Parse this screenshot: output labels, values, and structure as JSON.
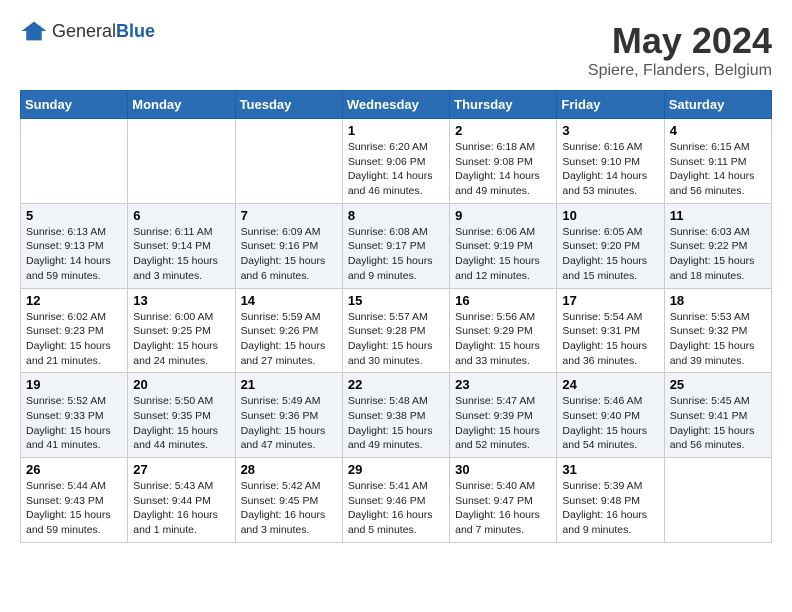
{
  "header": {
    "logo_general": "General",
    "logo_blue": "Blue",
    "title": "May 2024",
    "subtitle": "Spiere, Flanders, Belgium"
  },
  "calendar": {
    "days_of_week": [
      "Sunday",
      "Monday",
      "Tuesday",
      "Wednesday",
      "Thursday",
      "Friday",
      "Saturday"
    ],
    "weeks": [
      [
        {
          "day": "",
          "info": ""
        },
        {
          "day": "",
          "info": ""
        },
        {
          "day": "",
          "info": ""
        },
        {
          "day": "1",
          "info": "Sunrise: 6:20 AM\nSunset: 9:06 PM\nDaylight: 14 hours\nand 46 minutes."
        },
        {
          "day": "2",
          "info": "Sunrise: 6:18 AM\nSunset: 9:08 PM\nDaylight: 14 hours\nand 49 minutes."
        },
        {
          "day": "3",
          "info": "Sunrise: 6:16 AM\nSunset: 9:10 PM\nDaylight: 14 hours\nand 53 minutes."
        },
        {
          "day": "4",
          "info": "Sunrise: 6:15 AM\nSunset: 9:11 PM\nDaylight: 14 hours\nand 56 minutes."
        }
      ],
      [
        {
          "day": "5",
          "info": "Sunrise: 6:13 AM\nSunset: 9:13 PM\nDaylight: 14 hours\nand 59 minutes."
        },
        {
          "day": "6",
          "info": "Sunrise: 6:11 AM\nSunset: 9:14 PM\nDaylight: 15 hours\nand 3 minutes."
        },
        {
          "day": "7",
          "info": "Sunrise: 6:09 AM\nSunset: 9:16 PM\nDaylight: 15 hours\nand 6 minutes."
        },
        {
          "day": "8",
          "info": "Sunrise: 6:08 AM\nSunset: 9:17 PM\nDaylight: 15 hours\nand 9 minutes."
        },
        {
          "day": "9",
          "info": "Sunrise: 6:06 AM\nSunset: 9:19 PM\nDaylight: 15 hours\nand 12 minutes."
        },
        {
          "day": "10",
          "info": "Sunrise: 6:05 AM\nSunset: 9:20 PM\nDaylight: 15 hours\nand 15 minutes."
        },
        {
          "day": "11",
          "info": "Sunrise: 6:03 AM\nSunset: 9:22 PM\nDaylight: 15 hours\nand 18 minutes."
        }
      ],
      [
        {
          "day": "12",
          "info": "Sunrise: 6:02 AM\nSunset: 9:23 PM\nDaylight: 15 hours\nand 21 minutes."
        },
        {
          "day": "13",
          "info": "Sunrise: 6:00 AM\nSunset: 9:25 PM\nDaylight: 15 hours\nand 24 minutes."
        },
        {
          "day": "14",
          "info": "Sunrise: 5:59 AM\nSunset: 9:26 PM\nDaylight: 15 hours\nand 27 minutes."
        },
        {
          "day": "15",
          "info": "Sunrise: 5:57 AM\nSunset: 9:28 PM\nDaylight: 15 hours\nand 30 minutes."
        },
        {
          "day": "16",
          "info": "Sunrise: 5:56 AM\nSunset: 9:29 PM\nDaylight: 15 hours\nand 33 minutes."
        },
        {
          "day": "17",
          "info": "Sunrise: 5:54 AM\nSunset: 9:31 PM\nDaylight: 15 hours\nand 36 minutes."
        },
        {
          "day": "18",
          "info": "Sunrise: 5:53 AM\nSunset: 9:32 PM\nDaylight: 15 hours\nand 39 minutes."
        }
      ],
      [
        {
          "day": "19",
          "info": "Sunrise: 5:52 AM\nSunset: 9:33 PM\nDaylight: 15 hours\nand 41 minutes."
        },
        {
          "day": "20",
          "info": "Sunrise: 5:50 AM\nSunset: 9:35 PM\nDaylight: 15 hours\nand 44 minutes."
        },
        {
          "day": "21",
          "info": "Sunrise: 5:49 AM\nSunset: 9:36 PM\nDaylight: 15 hours\nand 47 minutes."
        },
        {
          "day": "22",
          "info": "Sunrise: 5:48 AM\nSunset: 9:38 PM\nDaylight: 15 hours\nand 49 minutes."
        },
        {
          "day": "23",
          "info": "Sunrise: 5:47 AM\nSunset: 9:39 PM\nDaylight: 15 hours\nand 52 minutes."
        },
        {
          "day": "24",
          "info": "Sunrise: 5:46 AM\nSunset: 9:40 PM\nDaylight: 15 hours\nand 54 minutes."
        },
        {
          "day": "25",
          "info": "Sunrise: 5:45 AM\nSunset: 9:41 PM\nDaylight: 15 hours\nand 56 minutes."
        }
      ],
      [
        {
          "day": "26",
          "info": "Sunrise: 5:44 AM\nSunset: 9:43 PM\nDaylight: 15 hours\nand 59 minutes."
        },
        {
          "day": "27",
          "info": "Sunrise: 5:43 AM\nSunset: 9:44 PM\nDaylight: 16 hours\nand 1 minute."
        },
        {
          "day": "28",
          "info": "Sunrise: 5:42 AM\nSunset: 9:45 PM\nDaylight: 16 hours\nand 3 minutes."
        },
        {
          "day": "29",
          "info": "Sunrise: 5:41 AM\nSunset: 9:46 PM\nDaylight: 16 hours\nand 5 minutes."
        },
        {
          "day": "30",
          "info": "Sunrise: 5:40 AM\nSunset: 9:47 PM\nDaylight: 16 hours\nand 7 minutes."
        },
        {
          "day": "31",
          "info": "Sunrise: 5:39 AM\nSunset: 9:48 PM\nDaylight: 16 hours\nand 9 minutes."
        },
        {
          "day": "",
          "info": ""
        }
      ]
    ]
  }
}
